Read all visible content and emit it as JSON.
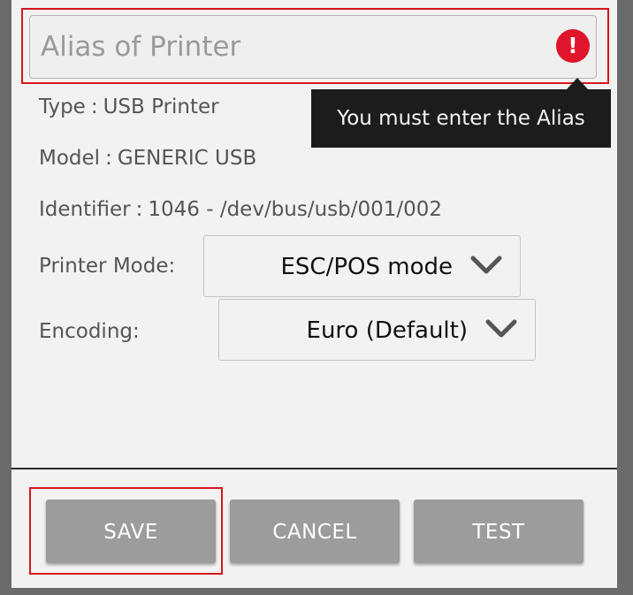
{
  "alias": {
    "placeholder": "Alias of Printer",
    "value": "",
    "error_icon_glyph": "!",
    "error_message": "You must enter the Alias"
  },
  "info": {
    "type_label": "Type",
    "type_value": "USB Printer",
    "model_label": "Model",
    "model_value": "GENERIC USB",
    "identifier_label": "Identifier",
    "identifier_value": "1046 - /dev/bus/usb/001/002",
    "separator": ":"
  },
  "printer_mode": {
    "label": "Printer Mode:",
    "selected": "ESC/POS mode"
  },
  "encoding": {
    "label": "Encoding:",
    "selected": "Euro (Default)"
  },
  "buttons": {
    "save": "SAVE",
    "cancel": "CANCEL",
    "test": "TEST"
  },
  "colors": {
    "error_red": "#e0142a",
    "highlight_red": "#d8151c",
    "tooltip_bg": "#1c1c1c",
    "button_bg": "#9c9c9c",
    "dialog_bg": "#f2f2f2"
  },
  "icons": {
    "error": "error-icon",
    "dropdown": "chevron-down-icon"
  }
}
